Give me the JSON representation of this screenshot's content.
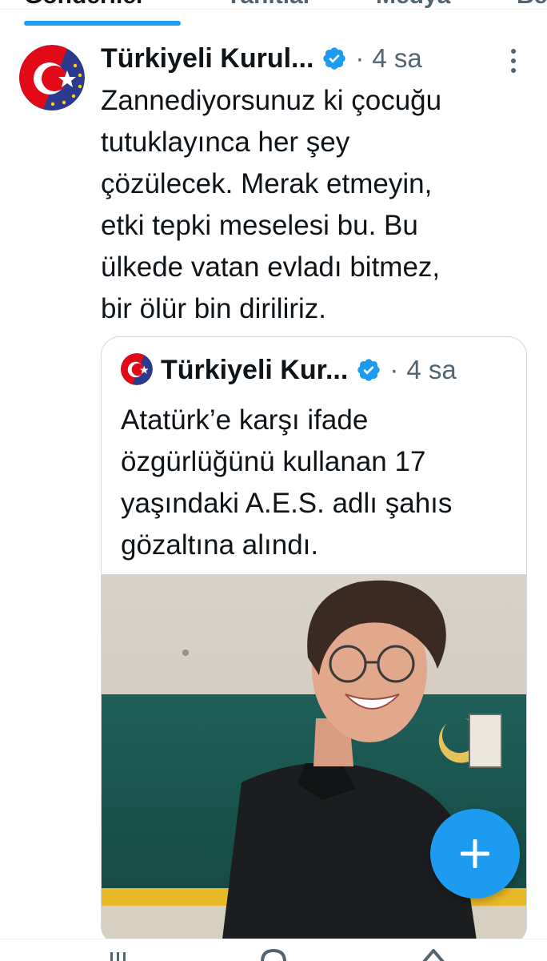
{
  "tabs": {
    "items": [
      {
        "label": "Gönderiler",
        "active": true
      },
      {
        "label": "Yanıtlar",
        "active": false
      },
      {
        "label": "Medya",
        "active": false
      },
      {
        "label": "Beğeni",
        "active": false
      }
    ]
  },
  "tweet": {
    "author_name": "Türkiyeli Kurul...",
    "verified_icon": "verified-badge-icon",
    "dot": "·",
    "time": "4 sa",
    "more_icon": "more-vertical-icon",
    "text": "Zannediyorsunuz ki çocuğu\ntutuklayınca her şey\nçözülecek. Merak etmeyin,\netki tepki meselesi bu. Bu\nülkede vatan evladı bitmez,\nbir ölür bin diriliriz."
  },
  "quote": {
    "author_name": "Türkiyeli Kur...",
    "dot": "·",
    "time": "4 sa",
    "text": "Atatürk’e karşı ifade\nözgürlüğünü kullanan 17\nyaşındaki A.E.S. adlı şahıs\ngözaltına alındı."
  },
  "fab": {
    "icon": "plus-icon"
  },
  "colors": {
    "accent": "#1d9bf0",
    "text": "#0f1419",
    "muted": "#536471",
    "border": "#cfd9de"
  }
}
